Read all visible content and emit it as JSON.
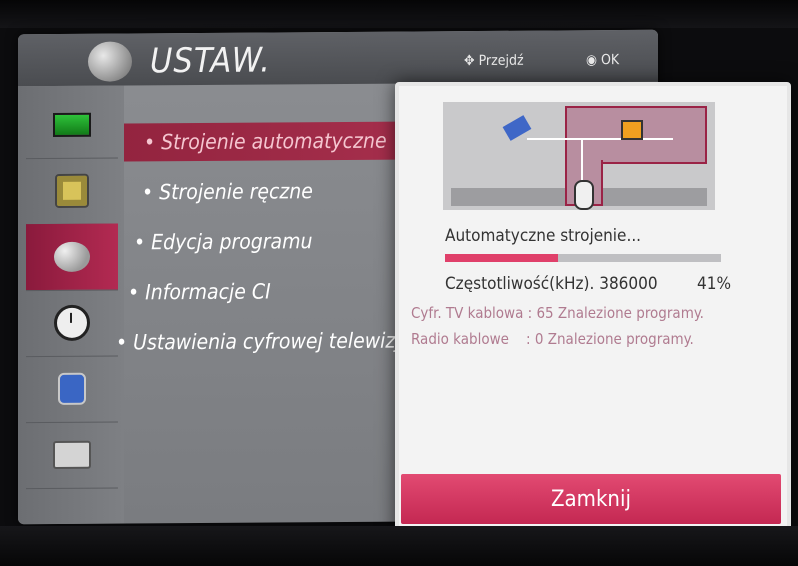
{
  "menu": {
    "title": "USTAW.",
    "hint_move": "Przejdź",
    "hint_ok": "OK",
    "sidebar_icons": [
      "screen-icon",
      "speaker-icon",
      "satellite-dish-icon",
      "clock-icon",
      "lock-icon",
      "briefcase-icon"
    ],
    "items": [
      {
        "label": "• Strojenie automatyczne"
      },
      {
        "label": "• Strojenie ręczne"
      },
      {
        "label": "• Edycja programu"
      },
      {
        "label": "• Informacje CI"
      },
      {
        "label": "• Ustawienia cyfrowej telewizj"
      }
    ]
  },
  "dialog": {
    "progress_title": "Automatyczne strojenie...",
    "progress_fraction": 0.41,
    "freq_label": "Częstotliwość(kHz). 386000",
    "freq_percent": "41%",
    "digital_found": "Cyfr. TV kablowa : 65 Znalezione programy.",
    "radio_found": "Radio kablowe    : 0 Znalezione programy.",
    "close_label": "Zamknij"
  },
  "colors": {
    "accent": "#c42852",
    "selected_row": "#93243f",
    "found_text": "#b07b90"
  }
}
